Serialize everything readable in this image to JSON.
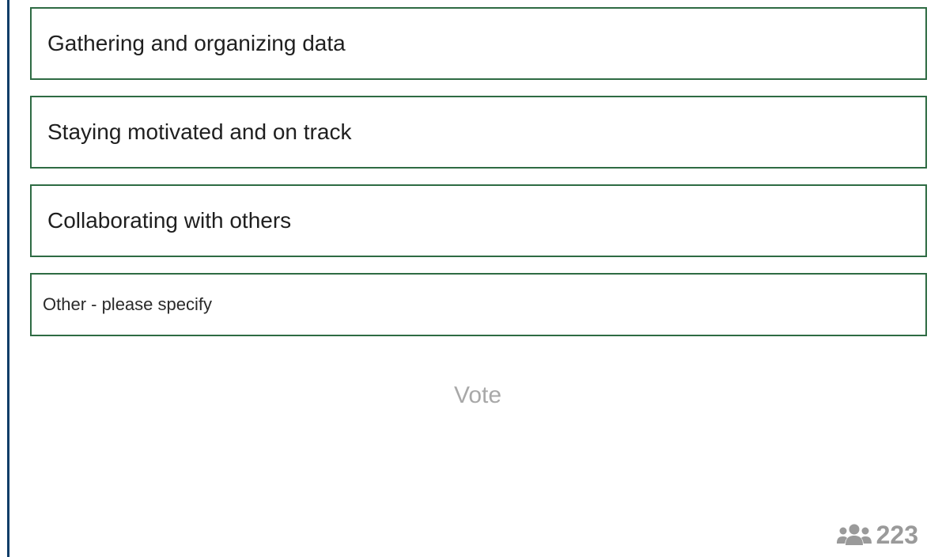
{
  "poll": {
    "options": [
      {
        "label": "Gathering and organizing data"
      },
      {
        "label": "Staying motivated and on track"
      },
      {
        "label": "Collaborating with others"
      }
    ],
    "other": {
      "placeholder": "Other - please specify",
      "value": ""
    },
    "vote_label": "Vote",
    "participant_count": "223",
    "participant_icon": "users-icon"
  },
  "colors": {
    "left_rule": "#0f3d68",
    "option_border": "#2e6b43",
    "muted_text": "#9a9a9a"
  }
}
